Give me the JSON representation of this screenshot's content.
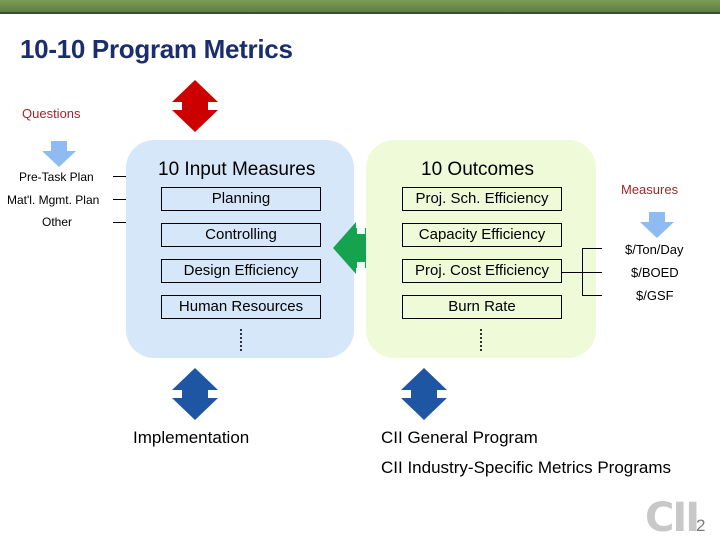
{
  "title": "10-10 Program Metrics",
  "labels": {
    "questions": "Questions",
    "measures": "Measures"
  },
  "questions_list": [
    "Pre-Task Plan",
    "Mat'l. Mgmt. Plan",
    "Other"
  ],
  "input_panel": {
    "title": "10 Input Measures",
    "items": [
      "Planning",
      "Controlling",
      "Design Efficiency",
      "Human Resources"
    ],
    "more_indicator": "..."
  },
  "outcome_panel": {
    "title": "10 Outcomes",
    "items": [
      "Proj. Sch. Efficiency",
      "Capacity Efficiency",
      "Proj. Cost Efficiency",
      "Burn Rate"
    ],
    "more_indicator": "..."
  },
  "measures_list": [
    "$/Ton/Day",
    "$/BOED",
    "$/GSF"
  ],
  "bottom": {
    "implementation": "Implementation",
    "general_program": "CII General Program",
    "industry_programs": "CII Industry-Specific Metrics Programs"
  },
  "footer": {
    "logo": "CII",
    "page_number": "2"
  },
  "colors": {
    "header_bar": "#6b8e4b",
    "title": "#1a2e6b",
    "label_red": "#a3262a",
    "arrow_red": "#cc0000",
    "arrow_green": "#16a34f",
    "arrow_blue": "#1f56a3",
    "arrow_light_blue": "#8ebcf2",
    "input_panel": "#d6e7fa",
    "outcome_panel": "#eefad8"
  }
}
